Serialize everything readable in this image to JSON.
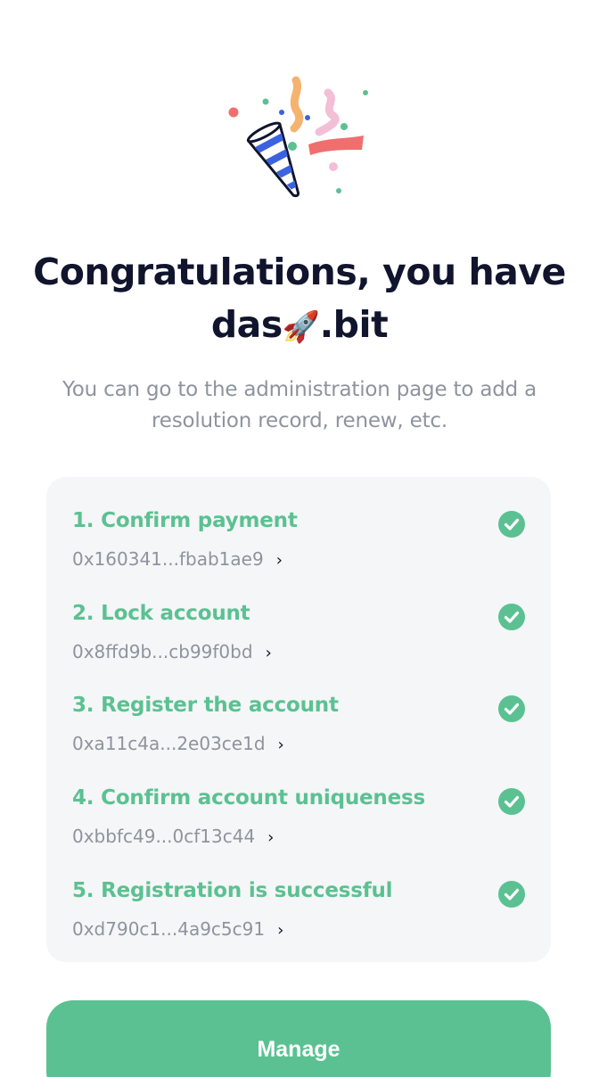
{
  "header": {
    "title_line1": "Congratulations, you have",
    "title_name": "das",
    "title_emoji": "🚀",
    "title_suffix": ".bit",
    "subtitle": "You can go to the administration page to add a resolution record, renew, etc."
  },
  "steps": [
    {
      "label": "1. Confirm payment",
      "hash": "0x160341...fbab1ae9",
      "status": "done"
    },
    {
      "label": "2. Lock account",
      "hash": "0x8ffd9b...cb99f0bd",
      "status": "done"
    },
    {
      "label": "3. Register the account",
      "hash": "0xa11c4a...2e03ce1d",
      "status": "done"
    },
    {
      "label": "4. Confirm account uniqueness",
      "hash": "0xbbfc49...0cf13c44",
      "status": "done"
    },
    {
      "label": "5. Registration is successful",
      "hash": "0xd790c1...4a9c5c91",
      "status": "done"
    }
  ],
  "icons": {
    "hero": "party-popper-icon",
    "step_status": "check-circle-icon",
    "hash_link": "chevron-right-icon"
  },
  "actions": {
    "manage_label": "Manage"
  },
  "colors": {
    "accent": "#5bc192",
    "title": "#11142d",
    "muted": "#8e939e",
    "card_bg": "#f5f6f7"
  }
}
